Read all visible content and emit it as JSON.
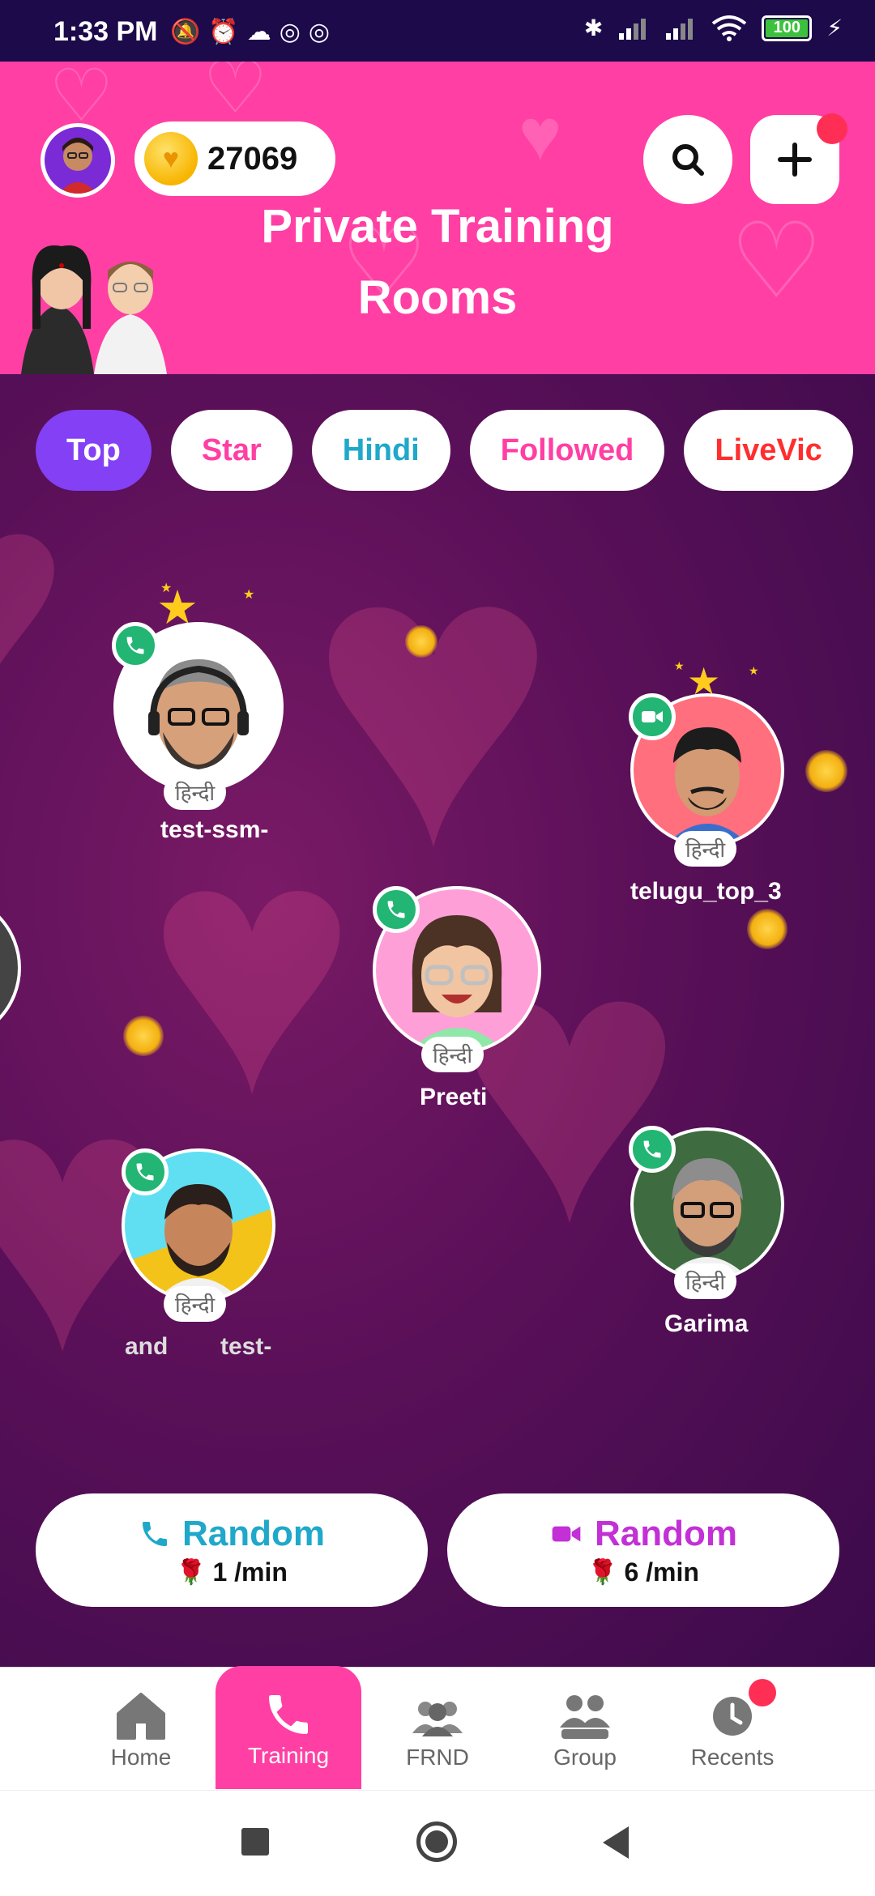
{
  "status_bar": {
    "time": "1:33 PM",
    "battery": "100"
  },
  "header": {
    "coins": "27069",
    "title_line1": "Private Training",
    "title_line2": "Rooms"
  },
  "tabs": [
    {
      "label": "Top",
      "color": "#ffffff",
      "active": true
    },
    {
      "label": "Star",
      "color": "#ff3fa4"
    },
    {
      "label": "Hindi",
      "color": "#1fa8c9"
    },
    {
      "label": "Followed",
      "color": "#ff3fa4"
    },
    {
      "label": "LiveVic",
      "color": "#ff2e2e"
    }
  ],
  "users": [
    {
      "name": "test-ssm-",
      "lang": "हिन्दी",
      "call": "voice"
    },
    {
      "name": "telugu_top_3",
      "lang": "हिन्दी",
      "call": "video"
    },
    {
      "name": "Preeti",
      "lang": "हिन्दी",
      "call": "voice"
    },
    {
      "name": "and",
      "name2": "test-",
      "lang": "हिन्दी",
      "call": "voice"
    },
    {
      "name": "Garima",
      "lang": "हिन्दी",
      "call": "voice"
    }
  ],
  "random_buttons": [
    {
      "label": "Random",
      "rate": "1 /min",
      "type": "voice",
      "color": "#1fa8c9"
    },
    {
      "label": "Random",
      "rate": "6 /min",
      "type": "video",
      "color": "#c230d6"
    }
  ],
  "bottom_nav": [
    {
      "label": "Home"
    },
    {
      "label": "Training",
      "active": true
    },
    {
      "label": "FRND"
    },
    {
      "label": "Group"
    },
    {
      "label": "Recents"
    }
  ]
}
